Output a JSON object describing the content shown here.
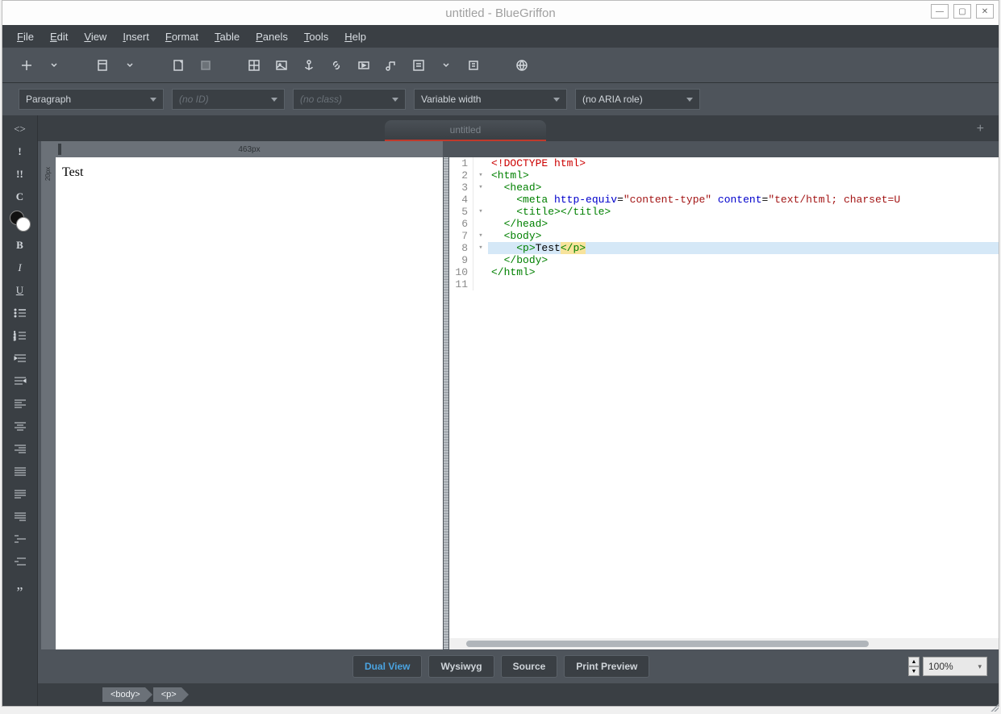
{
  "window": {
    "title": "untitled - BlueGriffon"
  },
  "menubar": [
    "File",
    "Edit",
    "View",
    "Insert",
    "Format",
    "Table",
    "Panels",
    "Tools",
    "Help"
  ],
  "dropdowns": {
    "element": "Paragraph",
    "id_placeholder": "(no ID)",
    "class_placeholder": "(no class)",
    "font": "Variable width",
    "aria": "(no ARIA role)"
  },
  "tab": {
    "label": "untitled",
    "modified": true
  },
  "ruler": {
    "width_label": "463px",
    "v_label": "20px"
  },
  "wysiwyg": {
    "content": "Test"
  },
  "source": {
    "lines": [
      {
        "n": 1,
        "fold": "",
        "html": "<span class='tok-doctype'>&lt;!DOCTYPE html&gt;</span>"
      },
      {
        "n": 2,
        "fold": "▾",
        "html": "<span class='tok-tag'>&lt;html&gt;</span>"
      },
      {
        "n": 3,
        "fold": "▾",
        "html": "  <span class='tok-tag'>&lt;head&gt;</span>"
      },
      {
        "n": 4,
        "fold": "",
        "html": "    <span class='tok-tag'>&lt;meta</span> <span class='tok-attr'>http-equiv</span>=<span class='tok-str'>\"content-type\"</span> <span class='tok-attr'>content</span>=<span class='tok-str'>\"text/html; charset=U</span>"
      },
      {
        "n": 5,
        "fold": "▾",
        "html": "    <span class='tok-tag'>&lt;title&gt;&lt;/title&gt;</span>"
      },
      {
        "n": 6,
        "fold": "",
        "html": "  <span class='tok-tag'>&lt;/head&gt;</span>"
      },
      {
        "n": 7,
        "fold": "▾",
        "html": "  <span class='tok-tag'>&lt;body&gt;</span>"
      },
      {
        "n": 8,
        "fold": "▾",
        "html": "    <span class='tok-tag'>&lt;p&gt;</span><span class='tok-text'>Test</span><span class='mark'><span class='tok-tag'>&lt;/p&gt;</span></span>",
        "hl": true
      },
      {
        "n": 9,
        "fold": "",
        "html": "  <span class='tok-tag'>&lt;/body&gt;</span>"
      },
      {
        "n": 10,
        "fold": "",
        "html": "<span class='tok-tag'>&lt;/html&gt;</span>"
      },
      {
        "n": 11,
        "fold": "",
        "html": ""
      }
    ]
  },
  "views": {
    "dual": "Dual View",
    "wysiwyg": "Wysiwyg",
    "source": "Source",
    "preview": "Print Preview",
    "active": "dual"
  },
  "zoom": {
    "value": "100%"
  },
  "breadcrumbs": [
    "<body>",
    "<p>"
  ]
}
